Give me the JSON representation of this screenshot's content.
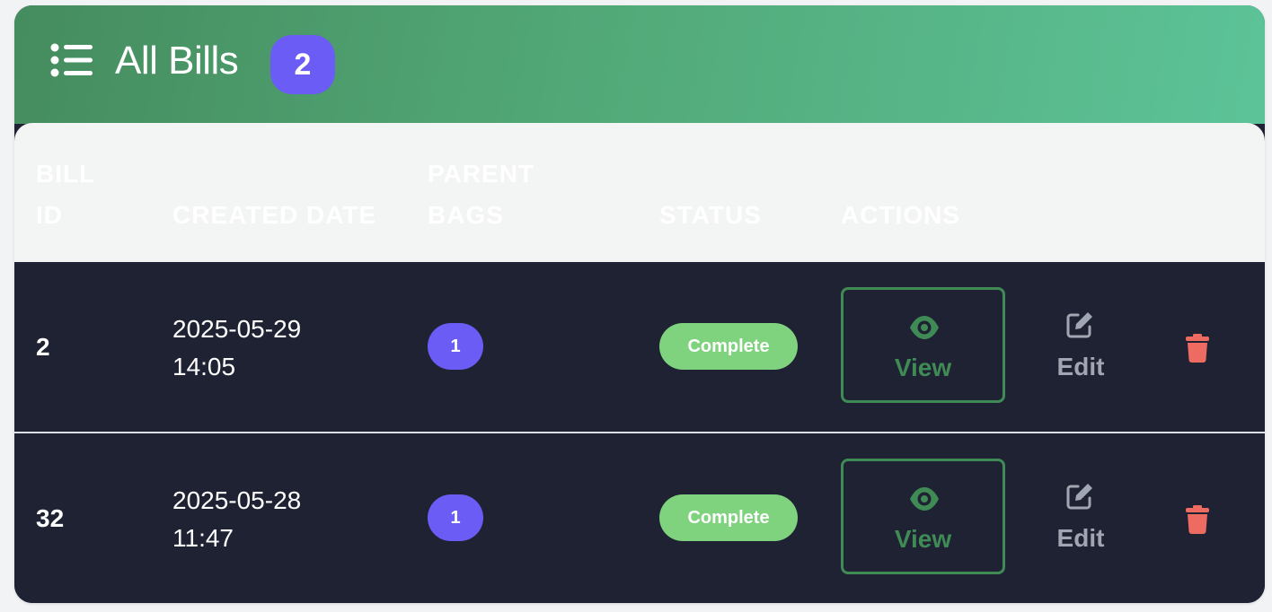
{
  "header": {
    "title": "All Bills",
    "count": "2",
    "icon": "list-icon",
    "gradient_colors": [
      "#458c5e",
      "#5cc398"
    ],
    "badge_color": "#6b5cf6"
  },
  "table": {
    "columns": [
      {
        "line1": "BILL",
        "line2": "ID"
      },
      {
        "line1": "",
        "line2": "CREATED DATE"
      },
      {
        "line1": "PARENT",
        "line2": "BAGS"
      },
      {
        "line1": "",
        "line2": "STATUS"
      },
      {
        "line1": "",
        "line2": "ACTIONS"
      }
    ],
    "rows": [
      {
        "bill_id": "2",
        "date_line1": "2025-05-29",
        "date_line2": "14:05",
        "parent_bags": "1",
        "status": "Complete",
        "actions": {
          "view": "View",
          "edit": "Edit"
        }
      },
      {
        "bill_id": "32",
        "date_line1": "2025-05-28",
        "date_line2": "11:47",
        "parent_bags": "1",
        "status": "Complete",
        "actions": {
          "view": "View",
          "edit": "Edit"
        }
      }
    ]
  },
  "colors": {
    "row_background": "#1e2233",
    "status_complete": "#7fd27e",
    "view_accent": "#3f8a55",
    "edit_gray": "#a1a6b3",
    "delete_red": "#ee6b62"
  }
}
